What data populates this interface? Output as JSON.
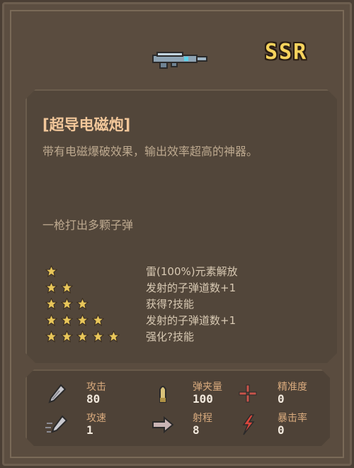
{
  "header": {
    "weapon_icon": "railgun-icon",
    "rarity": "SSR",
    "rarity_color": "#f6d35d"
  },
  "weapon": {
    "name": "[超导电磁炮]",
    "description": "带有电磁爆破效果，输出效率超高的神器。",
    "trait": "一枪打出多颗子弹"
  },
  "star_upgrades": [
    {
      "stars": 1,
      "text": "雷(100%)元素解放"
    },
    {
      "stars": 2,
      "text": "发射的子弹道数+1"
    },
    {
      "stars": 3,
      "text": "获得?技能"
    },
    {
      "stars": 4,
      "text": "发射的子弹道数+1"
    },
    {
      "stars": 5,
      "text": "强化?技能"
    }
  ],
  "stats": [
    {
      "icon": "sword-icon",
      "label": "攻击",
      "value": "80"
    },
    {
      "icon": "bullet-icon",
      "label": "弹夹量",
      "value": "100"
    },
    {
      "icon": "crosshair-icon",
      "label": "精准度",
      "value": "0"
    },
    {
      "icon": "attack-speed-icon",
      "label": "攻速",
      "value": "1"
    },
    {
      "icon": "arrow-range-icon",
      "label": "射程",
      "value": "8"
    },
    {
      "icon": "critical-bolt-icon",
      "label": "暴击率",
      "value": "0"
    }
  ],
  "colors": {
    "star": "#e8c65a",
    "name": "#f2c79a",
    "stat_label": "#d9ab7e"
  }
}
